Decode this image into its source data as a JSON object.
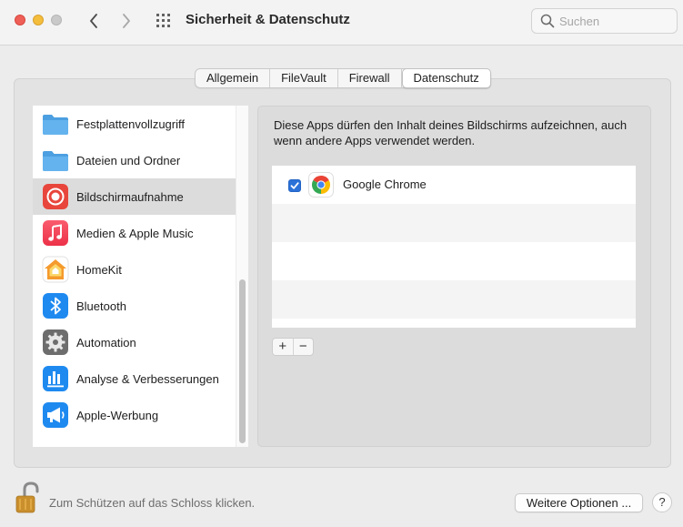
{
  "window": {
    "title": "Sicherheit & Datenschutz",
    "search_placeholder": "Suchen"
  },
  "tabs": [
    {
      "label": "Allgemein",
      "active": false
    },
    {
      "label": "FileVault",
      "active": false
    },
    {
      "label": "Firewall",
      "active": false
    },
    {
      "label": "Datenschutz",
      "active": true
    }
  ],
  "sidebar": {
    "items": [
      {
        "label": "Festplattenvollzugriff",
        "icon": "folder-icon"
      },
      {
        "label": "Dateien und Ordner",
        "icon": "folder-icon"
      },
      {
        "label": "Bildschirmaufnahme",
        "icon": "screen-recording-icon",
        "selected": true
      },
      {
        "label": "Medien & Apple Music",
        "icon": "music-icon"
      },
      {
        "label": "HomeKit",
        "icon": "home-icon"
      },
      {
        "label": "Bluetooth",
        "icon": "bluetooth-icon"
      },
      {
        "label": "Automation",
        "icon": "gear-icon"
      },
      {
        "label": "Analyse & Verbesserungen",
        "icon": "analytics-icon"
      },
      {
        "label": "Apple-Werbung",
        "icon": "megaphone-icon"
      }
    ]
  },
  "content": {
    "description": "Diese Apps dürfen den Inhalt deines Bildschirms aufzeichnen, auch wenn andere Apps verwendet werden.",
    "apps": [
      {
        "name": "Google Chrome",
        "checked": true,
        "icon": "chrome-icon"
      }
    ],
    "add_label": "+",
    "remove_label": "−"
  },
  "footer": {
    "lock_text": "Zum Schützen auf das Schloss klicken.",
    "more_options_label": "Weitere Optionen ...",
    "help_label": "?"
  },
  "colors": {
    "accent": "#2a72d8",
    "folder": "#5aa8e6",
    "screen_recording": "#e8463c",
    "music": "#f34b5f",
    "bluetooth": "#1e8af0",
    "gear": "#6d6d6d"
  }
}
